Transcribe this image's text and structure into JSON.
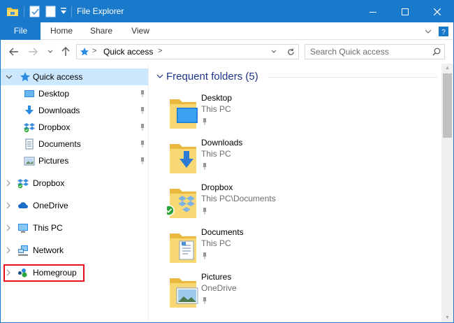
{
  "window": {
    "title": "File Explorer"
  },
  "ribbon": {
    "tabs": [
      "File",
      "Home",
      "Share",
      "View"
    ]
  },
  "address": {
    "location": "Quick access"
  },
  "search": {
    "placeholder": "Search Quick access"
  },
  "nav": {
    "quick_access": "Quick access",
    "pinned": [
      "Desktop",
      "Downloads",
      "Dropbox",
      "Documents",
      "Pictures"
    ],
    "roots": [
      "Dropbox",
      "OneDrive",
      "This PC",
      "Network",
      "Homegroup"
    ]
  },
  "content": {
    "section_title": "Frequent folders (5)",
    "folders": [
      {
        "name": "Desktop",
        "location": "This PC"
      },
      {
        "name": "Downloads",
        "location": "This PC"
      },
      {
        "name": "Dropbox",
        "location": "This PC\\Documents"
      },
      {
        "name": "Documents",
        "location": "This PC"
      },
      {
        "name": "Pictures",
        "location": "OneDrive"
      }
    ]
  },
  "colors": {
    "accent": "#1979ca",
    "selection": "#cce8ff",
    "highlight_box": "#e8101d",
    "section_title": "#1e3287"
  }
}
